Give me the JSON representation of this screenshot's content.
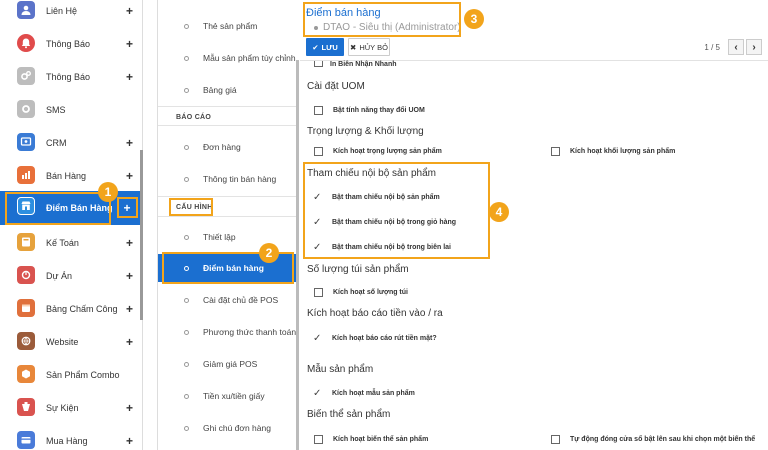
{
  "sidebar": {
    "items": [
      {
        "label": "Liên Hệ",
        "icon": "contacts-icon",
        "color": "#5b73c9",
        "plus": "+"
      },
      {
        "label": "Thông Báo",
        "icon": "bell-icon",
        "color": "#e04b4b",
        "plus": "+"
      },
      {
        "label": "Thông Báo",
        "icon": "gears-icon",
        "color": "#8d8d8d",
        "plus": "+"
      },
      {
        "label": "SMS",
        "icon": "sms-gear-icon",
        "color": "#8d8d8d",
        "plus": ""
      },
      {
        "label": "CRM",
        "icon": "crm-icon",
        "color": "#3a7bd5",
        "plus": "+"
      },
      {
        "label": "Bán Hàng",
        "icon": "sales-chart-icon",
        "color": "#e8703a",
        "plus": "+"
      },
      {
        "label": "Điểm Bán Hàng",
        "icon": "pos-store-icon",
        "color": "#2d8fe0",
        "plus": "+"
      },
      {
        "label": "Kế Toán",
        "icon": "accounting-icon",
        "color": "#e6a23c",
        "plus": "+"
      },
      {
        "label": "Dự Án",
        "icon": "project-icon",
        "color": "#d9534f",
        "plus": "+"
      },
      {
        "label": "Bảng Chấm Công",
        "icon": "timesheet-icon",
        "color": "#e0703c",
        "plus": "+"
      },
      {
        "label": "Website",
        "icon": "website-icon",
        "color": "#9b5b3a",
        "plus": "+"
      },
      {
        "label": "Sản Phẩm Combo",
        "icon": "combo-icon",
        "color": "#e8873a",
        "plus": ""
      },
      {
        "label": "Sự Kiện",
        "icon": "event-icon",
        "color": "#d9534f",
        "plus": "+"
      },
      {
        "label": "Mua Hàng",
        "icon": "purchase-icon",
        "color": "#4a7bd9",
        "plus": "+"
      }
    ],
    "active_color": "#1b6fd0"
  },
  "menu": {
    "top_items": [
      "Thẻ sản phẩm",
      "Mẫu sản phẩm tùy chỉnh",
      "Bảng giá"
    ],
    "section_reports": "BÁO CÁO",
    "report_items": [
      "Đơn hàng",
      "Thông tin bán hàng"
    ],
    "section_config": "CẤU HÌNH",
    "config_items": [
      "Thiết lập",
      "Điểm bán hàng",
      "Cài đặt chủ đề POS",
      "Phương thức thanh toán",
      "Giảm giá POS",
      "Tiền xu/tiền giấy",
      "Ghi chú đơn hàng"
    ]
  },
  "header": {
    "breadcrumb": "Điểm bán hàng",
    "record": "DTAO - Siêu thị (Administrator)",
    "save_label": "LƯU",
    "cancel_label": "HỦY BỎ",
    "pager": "1 / 5",
    "prev": "‹",
    "next": "›"
  },
  "form": {
    "cut_option": "In Biên Nhận Nhanh",
    "sections": [
      {
        "title": "Cài đặt UOM",
        "options": [
          {
            "label": "Bật tính năng thay đổi UOM",
            "checked": false
          }
        ]
      },
      {
        "title": "Trọng lượng & Khối lượng",
        "options": [
          {
            "label": "Kích hoạt trọng lượng sản phẩm",
            "checked": false
          },
          {
            "label": "Kích hoạt khối lượng sản phẩm",
            "checked": false
          }
        ]
      },
      {
        "title": "Tham chiếu nội bộ sản phẩm",
        "options": [
          {
            "label": "Bật tham chiếu nội bộ sản phẩm",
            "checked": true
          },
          {
            "label": "Bật tham chiếu nội bộ trong giỏ hàng",
            "checked": true
          },
          {
            "label": "Bật tham chiếu nội bộ trong biên lai",
            "checked": true
          }
        ]
      },
      {
        "title": "Số lượng túi sản phẩm",
        "options": [
          {
            "label": "Kích hoạt số lượng túi",
            "checked": false
          }
        ]
      },
      {
        "title": "Kích hoạt báo cáo tiền vào / ra",
        "options": [
          {
            "label": "Kích hoạt báo cáo rút tiền mặt?",
            "checked": true
          }
        ]
      },
      {
        "title": "Mẫu sản phẩm",
        "options": [
          {
            "label": "Kích hoạt mẫu sản phẩm",
            "checked": true
          }
        ]
      },
      {
        "title": "Biến thể sản phẩm",
        "options": [
          {
            "label": "Kích hoạt biến thể sản phẩm",
            "checked": false
          },
          {
            "label": "Tự động đóng cửa sổ bật lên sau khi chọn một biến thể",
            "checked": false
          }
        ]
      }
    ]
  },
  "annotations": [
    "1",
    "2",
    "3",
    "4"
  ],
  "highlight_color": "#f2a41b"
}
